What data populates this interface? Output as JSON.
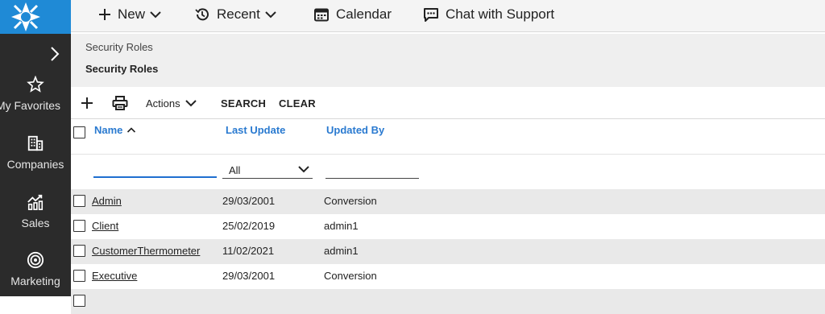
{
  "sidebar": {
    "items": [
      {
        "label": "My Favorites",
        "icon": "star-icon"
      },
      {
        "label": "Companies",
        "icon": "building-icon"
      },
      {
        "label": "Sales",
        "icon": "sales-chart-icon"
      },
      {
        "label": "Marketing",
        "icon": "target-icon"
      }
    ]
  },
  "topbar": {
    "new_label": "New",
    "recent_label": "Recent",
    "calendar_label": "Calendar",
    "chat_label": "Chat with Support"
  },
  "breadcrumb": {
    "parent": "Security Roles",
    "current": "Security Roles"
  },
  "toolbar": {
    "actions_label": "Actions",
    "search_label": "SEARCH",
    "clear_label": "CLEAR"
  },
  "table": {
    "columns": [
      "Name",
      "Last Update",
      "Updated By"
    ],
    "filter_last_update": "All",
    "rows": [
      {
        "name": "Admin",
        "last_update": "29/03/2001",
        "updated_by": "Conversion"
      },
      {
        "name": "Client",
        "last_update": "25/02/2019",
        "updated_by": "admin1"
      },
      {
        "name": "CustomerThermometer",
        "last_update": "11/02/2021",
        "updated_by": "admin1"
      },
      {
        "name": "Executive",
        "last_update": "29/03/2001",
        "updated_by": "Conversion"
      }
    ]
  },
  "colors": {
    "accent": "#2a7ad0",
    "sidebar_bg": "#2b2b2b",
    "logo_bg": "#1f8ad6"
  }
}
